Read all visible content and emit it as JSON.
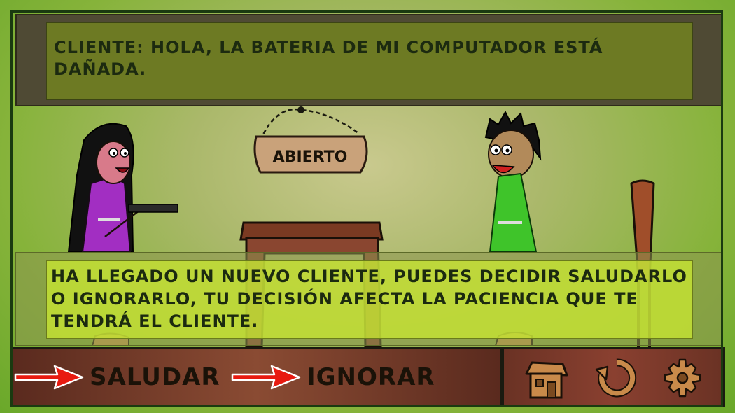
{
  "dialog": {
    "customer_line": "CLIENTE: HOLA, LA BATERIA DE MI COMPUTADOR ESTÁ DAÑADA."
  },
  "sign": {
    "label": "ABIERTO"
  },
  "narration": {
    "text": "HA LLEGADO UN NUEVO CLIENTE, PUEDES DECIDIR SALUDARLO O IGNORARLO, TU DECISIÓN AFECTA LA PACIENCIA QUE TE TENDRÁ EL CLIENTE."
  },
  "actions": {
    "greet_label": "SALUDAR",
    "ignore_label": "IGNORAR"
  },
  "menu": {
    "home_icon": "house-icon",
    "restart_icon": "restart-icon",
    "settings_icon": "gear-icon"
  },
  "colors": {
    "arrow": "#e81a10",
    "dialog_box": "#6d7a23",
    "narration_box": "#c8e632",
    "girl_dress": "#a22ec2",
    "boy_shirt": "#3fc42a"
  }
}
